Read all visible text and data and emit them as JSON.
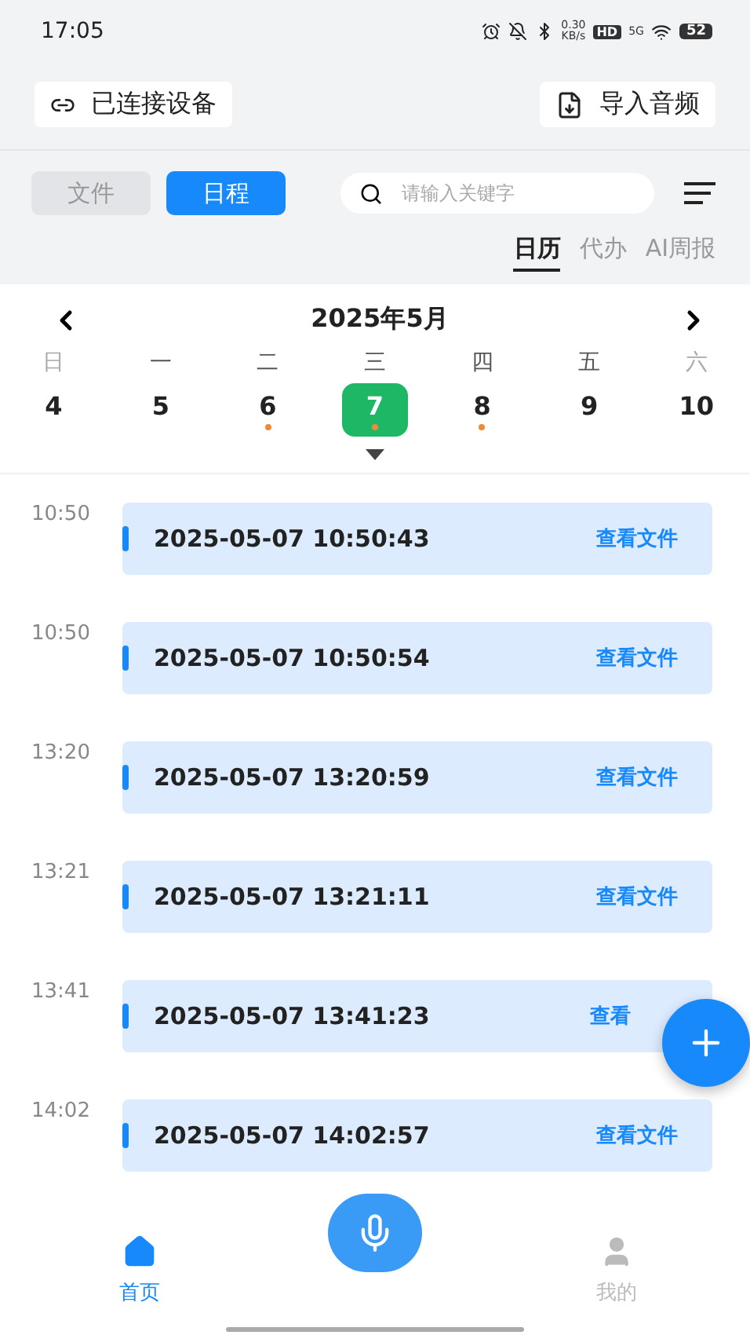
{
  "status_bar": {
    "time": "17:05",
    "net_speed": "0.30",
    "net_unit": "KB/s",
    "hd": "HD",
    "network": "5G",
    "battery": "52"
  },
  "header": {
    "device_button": "已连接设备",
    "import_button": "导入音频"
  },
  "toolbar": {
    "tabs": [
      {
        "label": "文件",
        "selected": false
      },
      {
        "label": "日程",
        "selected": true
      }
    ],
    "search": {
      "placeholder": "请输入关键字"
    }
  },
  "view_tabs": [
    {
      "label": "日历",
      "selected": true
    },
    {
      "label": "代办",
      "selected": false
    },
    {
      "label": "AI周报",
      "selected": false
    }
  ],
  "calendar": {
    "month": "2025年5月",
    "weekdays": [
      {
        "label": "日",
        "weekend": true
      },
      {
        "label": "一",
        "weekend": false
      },
      {
        "label": "二",
        "weekend": false
      },
      {
        "label": "三",
        "weekend": false
      },
      {
        "label": "四",
        "weekend": false
      },
      {
        "label": "五",
        "weekend": false
      },
      {
        "label": "六",
        "weekend": true
      }
    ],
    "days": [
      {
        "label": "4",
        "selected": false,
        "has_event": false
      },
      {
        "label": "5",
        "selected": false,
        "has_event": false
      },
      {
        "label": "6",
        "selected": false,
        "has_event": true
      },
      {
        "label": "7",
        "selected": true,
        "has_event": true
      },
      {
        "label": "8",
        "selected": false,
        "has_event": true
      },
      {
        "label": "9",
        "selected": false,
        "has_event": false
      },
      {
        "label": "10",
        "selected": false,
        "has_event": false
      }
    ]
  },
  "schedule": [
    {
      "time": "10:50",
      "title": "2025-05-07 10:50:43",
      "link": "查看文件"
    },
    {
      "time": "10:50",
      "title": "2025-05-07 10:50:54",
      "link": "查看文件"
    },
    {
      "time": "13:20",
      "title": "2025-05-07 13:20:59",
      "link": "查看文件"
    },
    {
      "time": "13:21",
      "title": "2025-05-07 13:21:11",
      "link": "查看文件"
    },
    {
      "time": "13:41",
      "title": "2025-05-07 13:41:23",
      "link": "查看"
    },
    {
      "time": "14:02",
      "title": "2025-05-07 14:02:57",
      "link": "查看文件"
    }
  ],
  "bottom_nav": [
    {
      "label": "首页",
      "selected": true,
      "kind": "home"
    },
    {
      "label": "我的",
      "selected": false,
      "kind": "profile"
    }
  ]
}
